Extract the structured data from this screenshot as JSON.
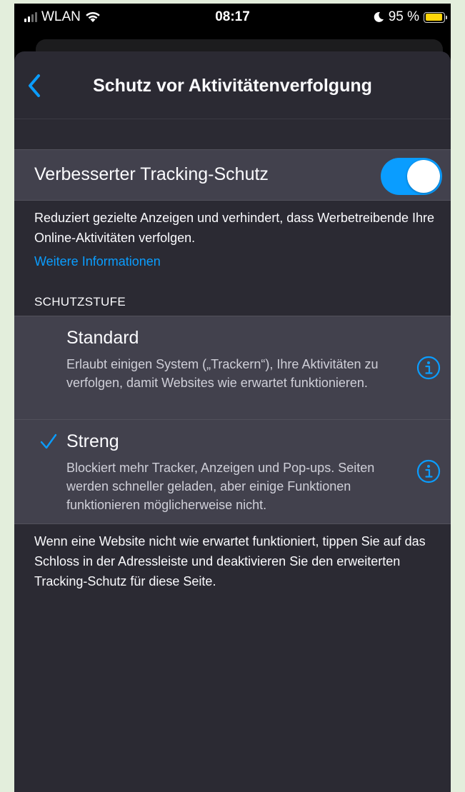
{
  "status_bar": {
    "carrier": "WLAN",
    "time": "08:17",
    "battery_percent": "95 %",
    "battery_level": 0.95,
    "battery_color": "#ffd60a",
    "icons": [
      "signal-icon",
      "wifi-icon",
      "moon-icon",
      "battery-icon"
    ]
  },
  "nav": {
    "title": "Schutz vor Aktivitätenverfolgung",
    "back_icon": "chevron-left-icon"
  },
  "toggle_row": {
    "label": "Verbesserter Tracking-Schutz",
    "enabled": true,
    "accent_color": "#0a9dff"
  },
  "description": "Reduziert gezielte Anzeigen und verhindert, dass Werbe­treibende Ihre Online-Aktivitäten verfolgen.",
  "more_link": "Weitere Informationen",
  "section_header": "SCHUTZSTUFE",
  "options": {
    "standard": {
      "title": "Standard",
      "description": "Erlaubt einigen System („Trackern“), Ihre Aktivitäten zu verfolgen, damit Websites wie erwartet funktionieren.",
      "selected": false
    },
    "strict": {
      "title": "Streng",
      "description": "Blockiert mehr Tracker, Anzeigen und Pop-ups. Seiten werden schneller geladen, aber einige Funktionen funktionieren möglicherweise nicht.",
      "selected": true
    }
  },
  "footer_note": "Wenn eine Website nicht wie erwartet funktioniert, tippen Sie auf das Schloss in der Adressleiste und deaktivieren Sie den erweiterten Tracking-Schutz für diese Seite.",
  "colors": {
    "background": "#2b2a33",
    "row": "#42414d",
    "accent": "#0a9dff"
  }
}
